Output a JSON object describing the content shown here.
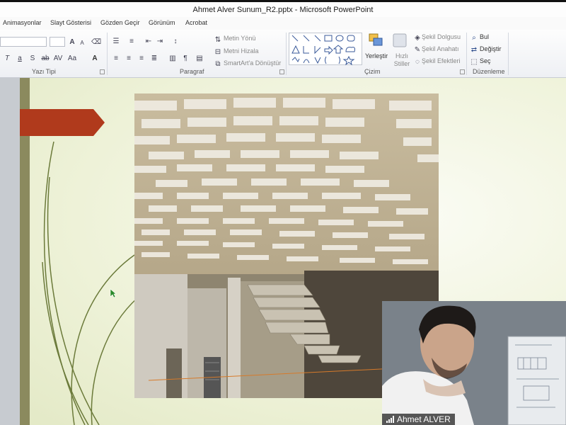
{
  "window": {
    "title": "Ahmet Alver Sunum_R2.pptx - Microsoft PowerPoint"
  },
  "menu": [
    "Animasyonlar",
    "Slayt Gösterisi",
    "Gözden Geçir",
    "Görünüm",
    "Acrobat"
  ],
  "ribbon": {
    "font_group": {
      "label": "Yazı Tipi"
    },
    "paragraph_group": {
      "label": "Paragraf",
      "text_direction": "Metin Yönü",
      "align_text": "Metni Hizala",
      "smartart": "SmartArt'a Dönüştür"
    },
    "drawing_group": {
      "label": "Çizim",
      "arrange": "Yerleştir",
      "quick_styles": "Hızlı Stiller",
      "shape_fill": "Şekil Dolgusu",
      "shape_outline": "Şekil Anahatı",
      "shape_effects": "Şekil Efektleri"
    },
    "editing_group": {
      "label": "Düzenleme",
      "find": "Bul",
      "replace": "Değiştir",
      "select": "Seç"
    }
  },
  "webcam": {
    "name": "Ahmet ALVER"
  },
  "colors": {
    "slide_bg": "#eef2d8",
    "stripe": "#8b8a5e",
    "arrow": "#b03a1c",
    "curves": "#6b7a3a"
  }
}
